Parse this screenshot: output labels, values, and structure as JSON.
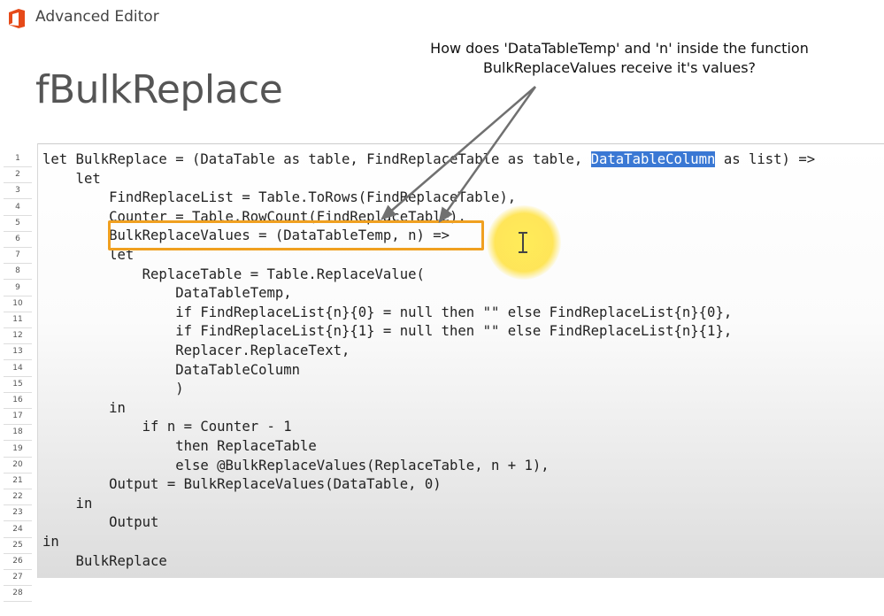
{
  "window": {
    "title": "Advanced Editor",
    "icon": "office-logo-icon",
    "accent_color": "#e64a19"
  },
  "query": {
    "name": "fBulkReplace"
  },
  "annotation": {
    "line1": "How does 'DataTableTemp' and 'n' inside the function",
    "line2": "BulkReplaceValues receive it's values?"
  },
  "editor": {
    "line_numbers": [
      "1",
      "2",
      "3",
      "4",
      "5",
      "6",
      "7",
      "8",
      "9",
      "10",
      "11",
      "12",
      "13",
      "14",
      "15",
      "16",
      "17",
      "18",
      "19",
      "20",
      "21",
      "22",
      "23",
      "24",
      "25",
      "26",
      "27",
      "28"
    ],
    "line1": {
      "before": "let BulkReplace = (DataTable as table, FindReplaceTable as table, ",
      "selected": "DataTableColumn",
      "after": " as list) =>"
    },
    "lines": [
      "    let",
      "        FindReplaceList = Table.ToRows(FindReplaceTable),",
      "        Counter = Table.RowCount(FindReplaceTable),",
      "        BulkReplaceValues = (DataTableTemp, n) =>",
      "        let",
      "            ReplaceTable = Table.ReplaceValue(",
      "                DataTableTemp,",
      "                if FindReplaceList{n}{0} = null then \"\" else FindReplaceList{n}{0},",
      "                if FindReplaceList{n}{1} = null then \"\" else FindReplaceList{n}{1},",
      "                Replacer.ReplaceText,",
      "                DataTableColumn",
      "                )",
      "        in",
      "            if n = Counter - 1",
      "                then ReplaceTable",
      "                else @BulkReplaceValues(ReplaceTable, n + 1),",
      "        Output = BulkReplaceValues(DataTable, 0)",
      "    in",
      "        Output",
      "in",
      "    BulkReplace"
    ],
    "selection_color": "#3a78d4",
    "highlight_color": "#f0a020"
  }
}
